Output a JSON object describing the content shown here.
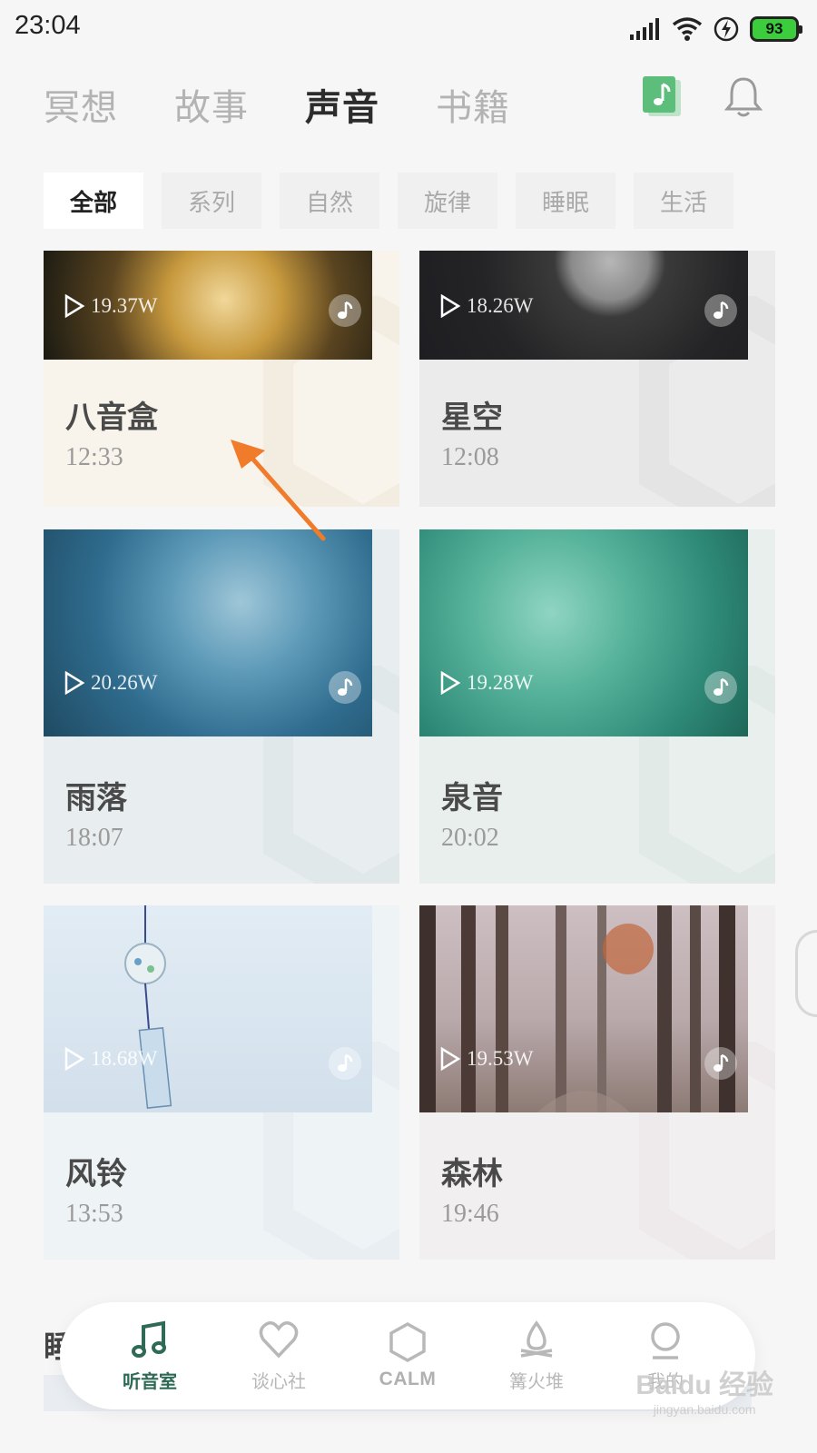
{
  "status_bar": {
    "time": "23:04",
    "battery": "93"
  },
  "top_tabs": [
    {
      "label": "冥想",
      "active": false
    },
    {
      "label": "故事",
      "active": false
    },
    {
      "label": "声音",
      "active": true
    },
    {
      "label": "书籍",
      "active": false
    }
  ],
  "top_actions": {
    "music_icon": "music-note-icon",
    "bell_icon": "bell-icon"
  },
  "filters": [
    {
      "label": "全部",
      "active": true
    },
    {
      "label": "系列",
      "active": false
    },
    {
      "label": "自然",
      "active": false
    },
    {
      "label": "旋律",
      "active": false
    },
    {
      "label": "睡眠",
      "active": false
    },
    {
      "label": "生活",
      "active": false
    }
  ],
  "cards": [
    {
      "title": "八音盒",
      "duration": "12:33",
      "plays": "19.37W"
    },
    {
      "title": "星空",
      "duration": "12:08",
      "plays": "18.26W"
    },
    {
      "title": "雨落",
      "duration": "18:07",
      "plays": "20.26W"
    },
    {
      "title": "泉音",
      "duration": "20:02",
      "plays": "19.28W"
    },
    {
      "title": "风铃",
      "duration": "13:53",
      "plays": "18.68W"
    },
    {
      "title": "森林",
      "duration": "19:46",
      "plays": "19.53W"
    }
  ],
  "section_peek": "睡眠",
  "bottom_nav": [
    {
      "label": "听音室",
      "icon": "music-note-icon",
      "active": true
    },
    {
      "label": "谈心社",
      "icon": "heart-icon",
      "active": false
    },
    {
      "label": "CALM",
      "icon": "hexagon-icon",
      "active": false
    },
    {
      "label": "篝火堆",
      "icon": "campfire-icon",
      "active": false
    },
    {
      "label": "我的",
      "icon": "profile-icon",
      "active": false
    }
  ],
  "watermark": {
    "main": "Baidu 经验",
    "sub": "jingyan.baidu.com"
  },
  "colors": {
    "accent": "#2e6a55",
    "background": "#f6f6f6",
    "arrow": "#f07b2a"
  }
}
